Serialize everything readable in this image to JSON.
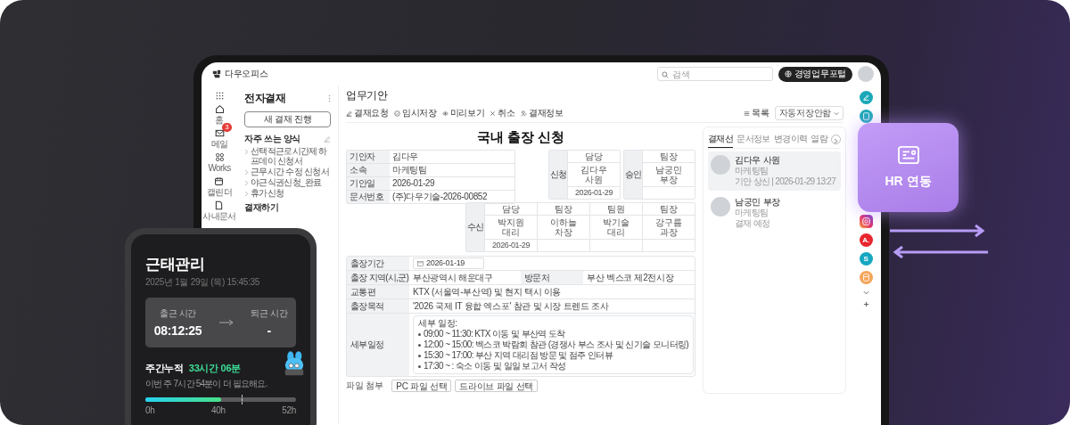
{
  "header": {
    "logo": "다우오피스",
    "search": {
      "placeholder": "검색"
    },
    "portal_button": "경영업무포털"
  },
  "nav_rail": [
    {
      "kind": "home",
      "label": "홈"
    },
    {
      "kind": "mail",
      "label": "메일",
      "badge": "3"
    },
    {
      "kind": "works",
      "label": "Works"
    },
    {
      "kind": "calendar",
      "label": "캘린더"
    },
    {
      "kind": "doc",
      "label": "사내문서"
    }
  ],
  "sidebar": {
    "title": "전자결재",
    "new_button": "새 결재 진행",
    "favorites_title": "자주 쓰는 양식",
    "favorites": [
      "선택적근로시간제 하프데이 신청서",
      "근무시간 수정 신청서",
      "야근식권신청_완료",
      "휴가신청"
    ],
    "section": "결재하기"
  },
  "page": {
    "title": "업무기안",
    "toolbar": [
      {
        "kind": "send",
        "label": "결재요청"
      },
      {
        "kind": "save",
        "label": "임시저장"
      },
      {
        "kind": "preview",
        "label": "미리보기"
      },
      {
        "kind": "cancel",
        "label": "취소"
      },
      {
        "kind": "info",
        "label": "결재정보"
      }
    ],
    "list_button": "목록",
    "autosave_select": "자동저장안함"
  },
  "document": {
    "title": "국내 출장 신청",
    "info": [
      {
        "label": "기안자",
        "value": "김다우"
      },
      {
        "label": "소속",
        "value": "마케팅팀"
      },
      {
        "label": "기안일",
        "value": "2026-01-29"
      },
      {
        "label": "문서번호",
        "value": "(주)다우기술-2026-00852"
      }
    ],
    "approval_lines": [
      {
        "groups": [
          {
            "label": "신청",
            "columns": [
              {
                "role": "담당",
                "name": "김다우",
                "rank": "사원",
                "date": "2026-01-29"
              }
            ]
          },
          {
            "label": "승인",
            "columns": [
              {
                "role": "팀장",
                "name": "남궁민",
                "rank": "부장"
              }
            ]
          }
        ]
      },
      {
        "groups": [
          {
            "label": "수신",
            "columns": [
              {
                "role": "담당",
                "name": "박지원",
                "rank": "대리",
                "date": "2026-01-29"
              },
              {
                "role": "팀장",
                "name": "이하늘",
                "rank": "차장"
              },
              {
                "role": "팀원",
                "name": "박기술",
                "rank": "대리"
              },
              {
                "role": "팀장",
                "name": "강구름",
                "rank": "과장"
              }
            ]
          }
        ]
      }
    ],
    "fields": [
      {
        "cells": [
          {
            "kind": "date",
            "label": "출장기간",
            "value": "2026-01-19"
          }
        ]
      },
      {
        "cells": [
          {
            "kind": "text",
            "label": "출장 지역(시,군)",
            "value": "부산광역시 해운대구"
          },
          {
            "kind": "text",
            "label": "방문처",
            "value": "부산 벡스코 제2전시장"
          }
        ]
      },
      {
        "cells": [
          {
            "kind": "text",
            "label": "교통편",
            "value": "KTX (서울역-부산역) 및 현지 택시 이용"
          }
        ]
      },
      {
        "cells": [
          {
            "kind": "text",
            "label": "출장목적",
            "value": "'2026 국제 IT 융합 엑스포' 참관 및 시장 트렌드 조사"
          }
        ]
      },
      {
        "cells": [
          {
            "kind": "detail",
            "label": "세부일정",
            "heading": "세부 일정:",
            "items": [
              "09:00 ~ 11:30: KTX 이동 및 부산역 도착",
              "12:00 ~ 15:00: 벡스코 박람회 참관 (경쟁사 부스 조사 및 신기술 모니터링)",
              "15:30 ~ 17:00: 부산 지역 대리점 방문 및 점주 인터뷰",
              "17:30 ~ : 숙소 이동 및 일일 보고서 작성"
            ]
          }
        ]
      }
    ],
    "attachments": {
      "label": "파일 첨부",
      "buttons": [
        "PC 파일 선택",
        "드라이브 파일 선택"
      ]
    }
  },
  "approval_panel": {
    "tabs": [
      {
        "label": "결재선",
        "selected": true
      },
      {
        "label": "문서정보",
        "selected": false
      },
      {
        "label": "변경이력",
        "selected": false
      },
      {
        "label": "열람",
        "selected": false
      }
    ],
    "people": [
      {
        "name": "김다우 사원",
        "team": "마케팅팀",
        "status": "기안 상신 | 2026-01-29 13:27",
        "selected": true
      },
      {
        "name": "남궁민 부장",
        "team": "마케팅팀",
        "status": "결재 예정",
        "selected": false
      }
    ]
  },
  "app_rail": [
    {
      "kind": "edit"
    },
    {
      "kind": "note"
    },
    {
      "kind": "instagram"
    },
    {
      "kind": "letter",
      "label": "A.",
      "color": "#e8262f"
    },
    {
      "kind": "letter",
      "label": "S",
      "color": "#17a7c0"
    },
    {
      "kind": "calculator"
    }
  ],
  "hr_card": {
    "label": "HR 연동"
  },
  "phone": {
    "title": "근태관리",
    "datetime": "2025년 1월 29일 (목) 15:45:35",
    "clock_in": {
      "label": "출근 시간",
      "value": "08:12:25"
    },
    "clock_out": {
      "label": "퇴근 시간",
      "value": "-"
    },
    "weekly": {
      "label": "주간누적",
      "value": "33시간 06분",
      "note": "이번 주 7시간 54분이 더 필요해요.",
      "level": 0.5,
      "ticks": [
        "0h",
        "40h",
        "52h"
      ]
    }
  }
}
